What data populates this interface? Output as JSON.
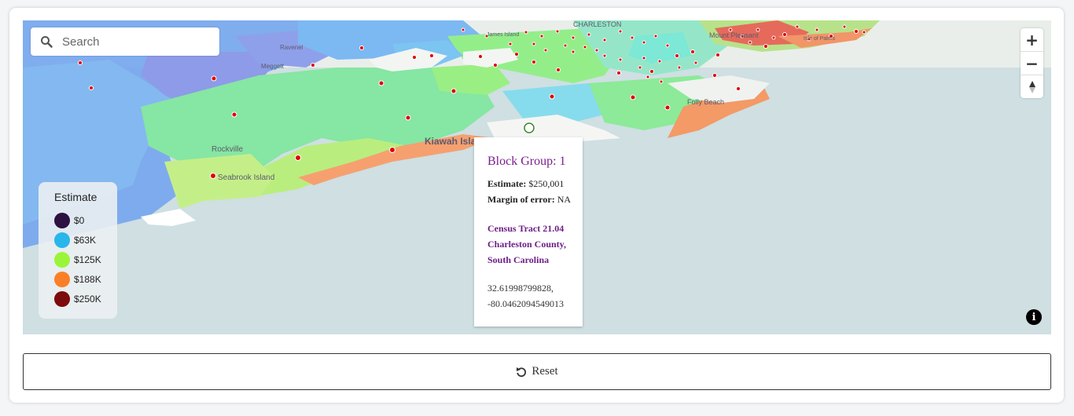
{
  "search": {
    "placeholder": "Search",
    "icon": "search-icon"
  },
  "zoom": {
    "in_label": "+",
    "out_label": "−",
    "compass_icon": "compass-icon"
  },
  "info": {
    "label": "i"
  },
  "legend": {
    "title": "Estimate",
    "items": [
      {
        "label": "$0",
        "color": "#2d1140"
      },
      {
        "label": "$63K",
        "color": "#29b6ea"
      },
      {
        "label": "$125K",
        "color": "#9af53a"
      },
      {
        "label": "$188K",
        "color": "#f98026"
      },
      {
        "label": "$250K",
        "color": "#7c0b0b"
      }
    ]
  },
  "popup": {
    "title": "Block Group: 1",
    "estimate_label": "Estimate:",
    "estimate_value": "$250,001",
    "moe_label": "Margin of error:",
    "moe_value": "NA",
    "tract_line1": "Census Tract 21.04",
    "tract_line2": "Charleston County,",
    "tract_line3": "South Carolina",
    "lat": "32.61998799828,",
    "lon": "-80.0462094549013"
  },
  "map_labels": {
    "kiawah": "Kiawah Isla",
    "rockville": "Rockville",
    "seabrook": "Seabrook Island",
    "folly": "Folly Beach",
    "ravenel": "Ravenel",
    "meggett": "Meggett",
    "james_island": "James Island",
    "mount_pleasant": "Mount Pleasant",
    "isle_of_palms": "Isle of Palms",
    "charleston": "CHARLESTON"
  },
  "reset": {
    "label": "Reset",
    "icon": "undo-icon"
  },
  "colors": {
    "water": "#cfdfe2",
    "marker": "#e00000"
  }
}
